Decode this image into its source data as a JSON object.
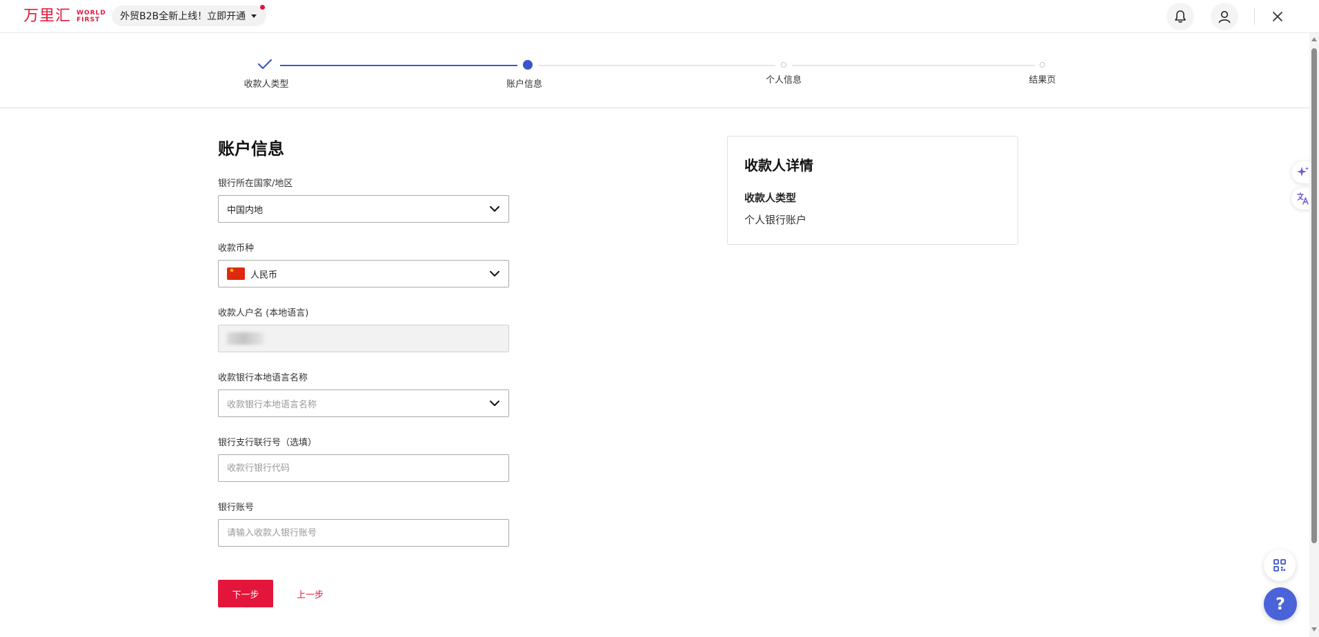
{
  "header": {
    "logo_cn": "万里汇",
    "logo_en_line1": "WORLD",
    "logo_en_line2": "FIRST",
    "promo_text": "外贸B2B全新上线！立即开通",
    "icons": [
      "bell-icon",
      "user-icon",
      "close-icon"
    ]
  },
  "stepper": {
    "steps": [
      {
        "label": "收款人类型",
        "state": "done"
      },
      {
        "label": "账户信息",
        "state": "active"
      },
      {
        "label": "个人信息",
        "state": "pending"
      },
      {
        "label": "结果页",
        "state": "pending"
      }
    ]
  },
  "form": {
    "title": "账户信息",
    "bank_country": {
      "label": "银行所在国家/地区",
      "value": "中国内地"
    },
    "currency": {
      "label": "收款币种",
      "value": "人民币",
      "flag": "china-flag-icon"
    },
    "account_name": {
      "label": "收款人户名 (本地语言)"
    },
    "bank_name": {
      "label": "收款银行本地语言名称",
      "placeholder": "收款银行本地语言名称"
    },
    "branch_code": {
      "label": "银行支行联行号（选填）",
      "placeholder": "收款行银行代码"
    },
    "account_number": {
      "label": "银行账号",
      "placeholder": "请输入收款人银行账号"
    },
    "next_label": "下一步",
    "prev_label": "上一步"
  },
  "details": {
    "title": "收款人详情",
    "type_label": "收款人类型",
    "type_value": "个人银行账户"
  },
  "floating": {
    "help_label": "?",
    "icons": [
      "sparkle-icon",
      "translate-icon",
      "qr-grid-icon"
    ]
  },
  "colors": {
    "brand": "#e3153a",
    "accent": "#3a56c8",
    "help": "#4a63d8"
  }
}
